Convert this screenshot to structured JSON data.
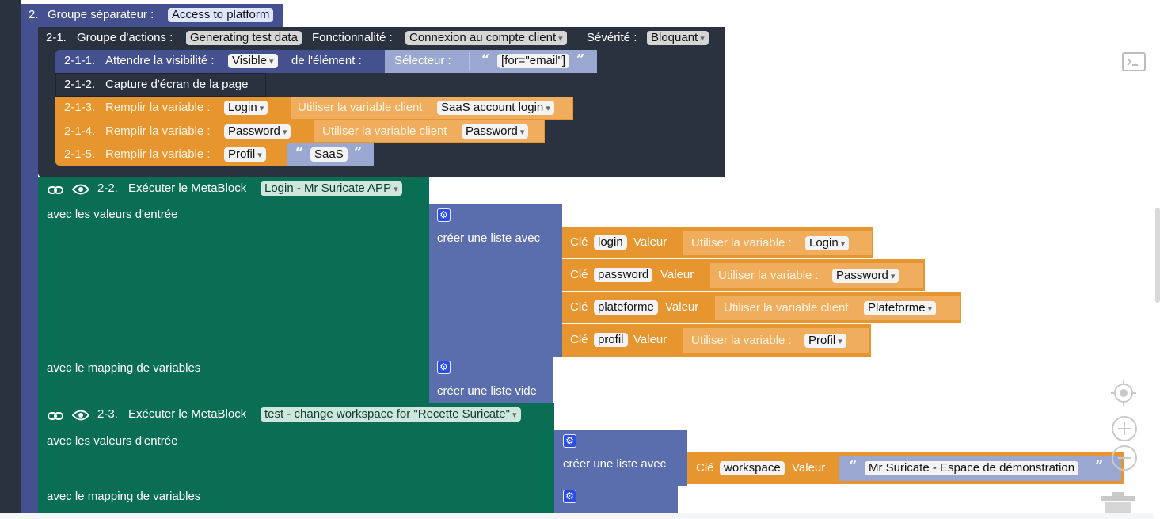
{
  "workspace": {
    "separator": {
      "number": "2.",
      "label": "Groupe séparateur :",
      "name": "Access to platform"
    },
    "action_group": {
      "number": "2-1.",
      "label": "Groupe d'actions :",
      "name": "Generating test data",
      "feature_label": "Fonctionnalité :",
      "feature": "Connexion au compte client",
      "severity_label": "Sévérité :",
      "severity": "Bloquant",
      "steps": [
        {
          "number": "2-1-1.",
          "label": "Attendre la visibilité :",
          "state": "Visible",
          "of_element": "de l'élément :",
          "selector_label": "Sélecteur :",
          "selector": "[for=\"email\"]"
        },
        {
          "number": "2-1-2.",
          "label": "Capture d'écran de la page"
        },
        {
          "number": "2-1-3.",
          "label": "Remplir la variable :",
          "variable": "Login",
          "source_label": "Utiliser la variable client",
          "source": "SaaS account login"
        },
        {
          "number": "2-1-4.",
          "label": "Remplir la variable :",
          "variable": "Password",
          "source_label": "Utiliser la variable client",
          "source": "Password"
        },
        {
          "number": "2-1-5.",
          "label": "Remplir la variable :",
          "variable": "Profil",
          "text": "SaaS"
        }
      ]
    },
    "metablocks": [
      {
        "number": "2-2.",
        "label": "Exécuter le MetaBlock",
        "name": "Login - Mr Suricate APP",
        "inputs_label": "avec les valeurs d'entrée",
        "list_label": "créer une liste avec",
        "entries": [
          {
            "key_label": "Clé",
            "key": "login",
            "value_label": "Valeur",
            "source_label": "Utiliser la variable :",
            "source": "Login"
          },
          {
            "key_label": "Clé",
            "key": "password",
            "value_label": "Valeur",
            "source_label": "Utiliser la variable :",
            "source": "Password"
          },
          {
            "key_label": "Clé",
            "key": "plateforme",
            "value_label": "Valeur",
            "source_label": "Utiliser la variable client",
            "source": "Plateforme"
          },
          {
            "key_label": "Clé",
            "key": "profil",
            "value_label": "Valeur",
            "source_label": "Utiliser la variable :",
            "source": "Profil"
          }
        ],
        "mapping_label": "avec le mapping de variables",
        "mapping_list_label": "créer une liste vide"
      },
      {
        "number": "2-3.",
        "label": "Exécuter le MetaBlock",
        "name": "test - change workspace for \"Recette Suricate\"",
        "inputs_label": "avec les valeurs d'entrée",
        "list_label": "créer une liste avec",
        "entry": {
          "key_label": "Clé",
          "key": "workspace",
          "value_label": "Valeur",
          "text": "Mr Suricate - Espace de démonstration"
        },
        "mapping_label": "avec le mapping de variables"
      }
    ],
    "quote_open": "“",
    "quote_close": "”",
    "gear_glyph": "⚙"
  },
  "controls": {
    "console_icon": "console-icon",
    "recenter_icon": "crosshair-icon",
    "zoom_in_icon": "plus-icon",
    "zoom_out_icon": "minus-icon",
    "trash_icon": "trash-icon"
  },
  "colors": {
    "separator": "#45508f",
    "action_group": "#2a3240",
    "metablock": "#0a6e55",
    "list": "#5a6ead",
    "variable": "#e7952f",
    "text": "#9aa7d0"
  }
}
